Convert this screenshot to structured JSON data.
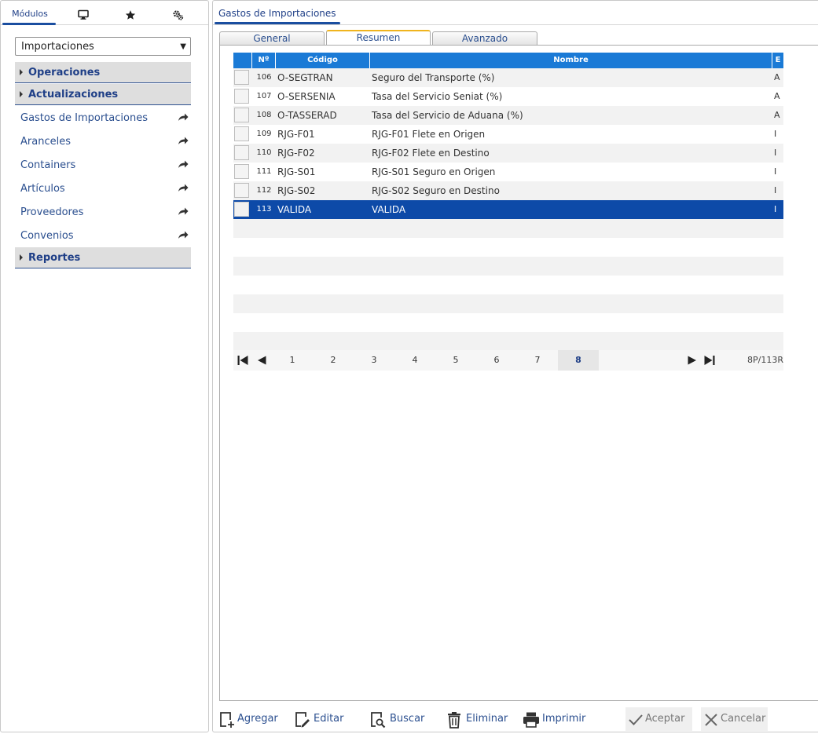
{
  "left_tabs": {
    "modulos_label": "Módulos"
  },
  "module_select": {
    "value": "Importaciones"
  },
  "sections": {
    "operaciones": "Operaciones",
    "actualizaciones": "Actualizaciones",
    "reportes": "Reportes"
  },
  "menu_items": [
    {
      "label": "Gastos de Importaciones"
    },
    {
      "label": "Aranceles"
    },
    {
      "label": "Containers"
    },
    {
      "label": "Artículos"
    },
    {
      "label": "Proveedores"
    },
    {
      "label": "Convenios"
    }
  ],
  "window": {
    "title": "Gastos de Importaciones"
  },
  "form_tabs": {
    "general": "General",
    "resumen": "Resumen",
    "avanzado": "Avanzado",
    "active": "Resumen"
  },
  "grid": {
    "columns": {
      "num": "Nº",
      "codigo": "Código",
      "nombre": "Nombre",
      "estado": "E"
    },
    "rows": [
      {
        "num": "106",
        "codigo": "O-SEGTRAN",
        "nombre": "Seguro del Transporte (%)",
        "estado": "A"
      },
      {
        "num": "107",
        "codigo": "O-SERSENIA",
        "nombre": "Tasa del Servicio Seniat (%)",
        "estado": "A"
      },
      {
        "num": "108",
        "codigo": "O-TASSERAD",
        "nombre": "Tasa del Servicio de Aduana (%)",
        "estado": "A"
      },
      {
        "num": "109",
        "codigo": "RJG-F01",
        "nombre": "RJG-F01 Flete en Origen",
        "estado": "I"
      },
      {
        "num": "110",
        "codigo": "RJG-F02",
        "nombre": "RJG-F02 Flete en Destino",
        "estado": "I"
      },
      {
        "num": "111",
        "codigo": "RJG-S01",
        "nombre": "RJG-S01 Seguro en Origen",
        "estado": "I"
      },
      {
        "num": "112",
        "codigo": "RJG-S02",
        "nombre": "RJG-S02 Seguro en Destino",
        "estado": "I"
      },
      {
        "num": "113",
        "codigo": "VALIDA",
        "nombre": "VALIDA",
        "estado": "I",
        "selected": true
      }
    ]
  },
  "pager": {
    "pages": [
      "1",
      "2",
      "3",
      "4",
      "5",
      "6",
      "7",
      "8"
    ],
    "current_page": "8",
    "info": "8P/113R"
  },
  "toolbar": {
    "agregar": "Agregar",
    "editar": "Editar",
    "buscar": "Buscar",
    "eliminar": "Eliminar",
    "imprimir": "Imprimir",
    "aceptar": "Aceptar",
    "cancelar": "Cancelar"
  },
  "colors": {
    "accent": "#1a4ea0",
    "header": "#1a7ad6",
    "selected_row": "#0d4aa8",
    "active_tab_top": "#f0b41e"
  }
}
